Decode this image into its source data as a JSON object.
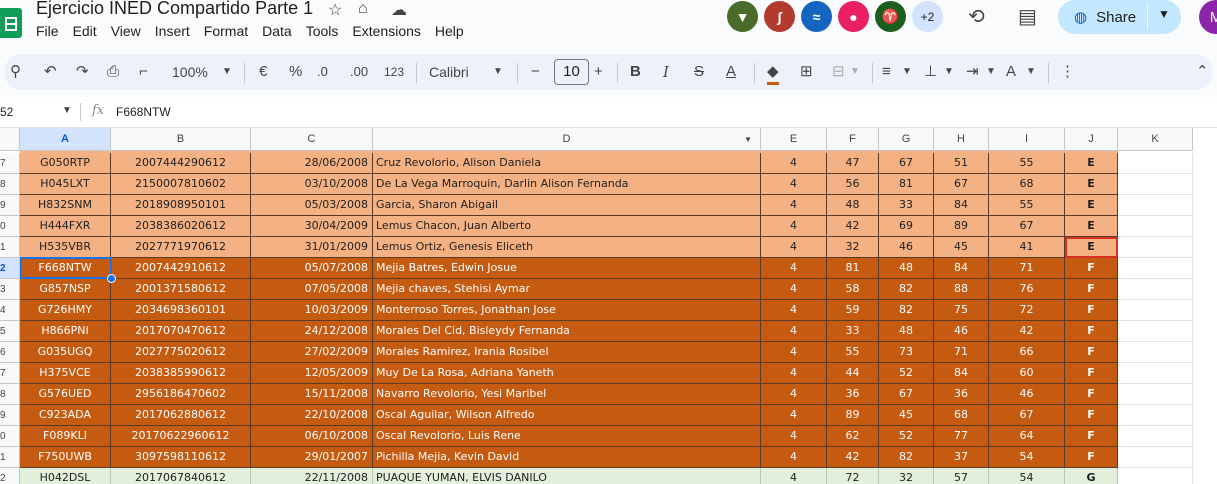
{
  "app": {
    "title": "Ejercicio INED Compartido Parte 1",
    "menu": [
      "File",
      "Edit",
      "View",
      "Insert",
      "Format",
      "Data",
      "Tools",
      "Extensions",
      "Help"
    ],
    "share_label": "Share",
    "more_collaborators": "+2",
    "user_initial": "M",
    "collaborators": [
      {
        "icon": "badger-avatar-icon",
        "color": "#4a6b2a"
      },
      {
        "icon": "swan-avatar-icon",
        "color": "#b23a2e"
      },
      {
        "icon": "dolphin-avatar-icon",
        "color": "#1565c0"
      },
      {
        "icon": "panda-avatar-icon",
        "color": "#e91e63"
      },
      {
        "icon": "ibex-avatar-icon",
        "color": "#1b5e20"
      }
    ]
  },
  "toolbar": {
    "zoom": "100%",
    "currency": "€",
    "percent": "%",
    "dec_decrease": ".0",
    "dec_increase": ".00",
    "number_format": "123",
    "font": "Calibri",
    "font_size": "10"
  },
  "formula_bar": {
    "cell_ref": "52",
    "content": "F668NTW"
  },
  "columns": [
    "A",
    "B",
    "C",
    "D",
    "E",
    "F",
    "G",
    "H",
    "I",
    "J",
    "K"
  ],
  "rows": [
    {
      "num": "7",
      "cells": [
        "G050RTP",
        "2007444290612",
        "28/06/2008",
        "Cruz Revolorio, Alison Daniela",
        "4",
        "47",
        "67",
        "51",
        "55",
        "E"
      ]
    },
    {
      "num": "8",
      "cells": [
        "H045LXT",
        "2150007810602",
        "03/10/2008",
        "De La Vega Marroquin, Darlin Alison Fernanda",
        "4",
        "56",
        "81",
        "67",
        "68",
        "E"
      ]
    },
    {
      "num": "9",
      "cells": [
        "H832SNM",
        "2018908950101",
        "05/03/2008",
        "Garcia, Sharon Abigail",
        "4",
        "48",
        "33",
        "84",
        "55",
        "E"
      ]
    },
    {
      "num": "0",
      "cells": [
        "H444FXR",
        "2038386020612",
        "30/04/2009",
        "Lemus Chacon, Juan Alberto",
        "4",
        "42",
        "69",
        "89",
        "67",
        "E"
      ]
    },
    {
      "num": "1",
      "cells": [
        "H535VBR",
        "2027771970612",
        "31/01/2009",
        "Lemus Ortiz, Genesis Eliceth",
        "4",
        "32",
        "46",
        "45",
        "41",
        "E"
      ]
    },
    {
      "num": "2",
      "cells": [
        "F668NTW",
        "2007442910612",
        "05/07/2008",
        "Mejia Batres, Edwin Josue",
        "4",
        "81",
        "48",
        "84",
        "71",
        "F"
      ]
    },
    {
      "num": "3",
      "cells": [
        "G857NSP",
        "2001371580612",
        "07/05/2008",
        "Mejia chaves, Stehisi Aymar",
        "4",
        "58",
        "82",
        "88",
        "76",
        "F"
      ]
    },
    {
      "num": "4",
      "cells": [
        "G726HMY",
        "2034698360101",
        "10/03/2009",
        "Monterroso Torres, Jonathan Jose",
        "4",
        "59",
        "82",
        "75",
        "72",
        "F"
      ]
    },
    {
      "num": "5",
      "cells": [
        "H866PNI",
        "2017070470612",
        "24/12/2008",
        "Morales Del Cid, Bisleydy Fernanda",
        "4",
        "33",
        "48",
        "46",
        "42",
        "F"
      ]
    },
    {
      "num": "6",
      "cells": [
        "G035UGQ",
        "2027775020612",
        "27/02/2009",
        "Morales Ramirez, Irania Rosibel",
        "4",
        "55",
        "73",
        "71",
        "66",
        "F"
      ]
    },
    {
      "num": "7",
      "cells": [
        "H375VCE",
        "2038385990612",
        "12/05/2009",
        "Muy De La Rosa, Adriana Yaneth",
        "4",
        "44",
        "52",
        "84",
        "60",
        "F"
      ]
    },
    {
      "num": "8",
      "cells": [
        "G576UED",
        "2956186470602",
        "15/11/2008",
        "Navarro Revolorio, Yesi Maribel",
        "4",
        "36",
        "67",
        "36",
        "46",
        "F"
      ]
    },
    {
      "num": "9",
      "cells": [
        "C923ADA",
        "2017062880612",
        "22/10/2008",
        "Oscal Aguilar, Wilson Alfredo",
        "4",
        "89",
        "45",
        "68",
        "67",
        "F"
      ]
    },
    {
      "num": "0",
      "cells": [
        "F089KLI",
        "20170622960612",
        "06/10/2008",
        "Oscal Revolorio, Luis Rene",
        "4",
        "62",
        "52",
        "77",
        "64",
        "F"
      ]
    },
    {
      "num": "1",
      "cells": [
        "F750UWB",
        "3097598110612",
        "29/01/2007",
        "Pichilla Mejia, Kevin David",
        "4",
        "42",
        "82",
        "37",
        "54",
        "F"
      ]
    },
    {
      "num": "2",
      "cells": [
        "H042DSL",
        "2017067840612",
        "22/11/2008",
        "PUAQUE YUMAN, ELVIS DANILO",
        "4",
        "72",
        "32",
        "57",
        "54",
        "G"
      ]
    }
  ],
  "colors": {
    "group_e": "#f4b183",
    "group_f": "#c55a11",
    "group_g": "#e2efda",
    "selection": "#1a73e8"
  }
}
